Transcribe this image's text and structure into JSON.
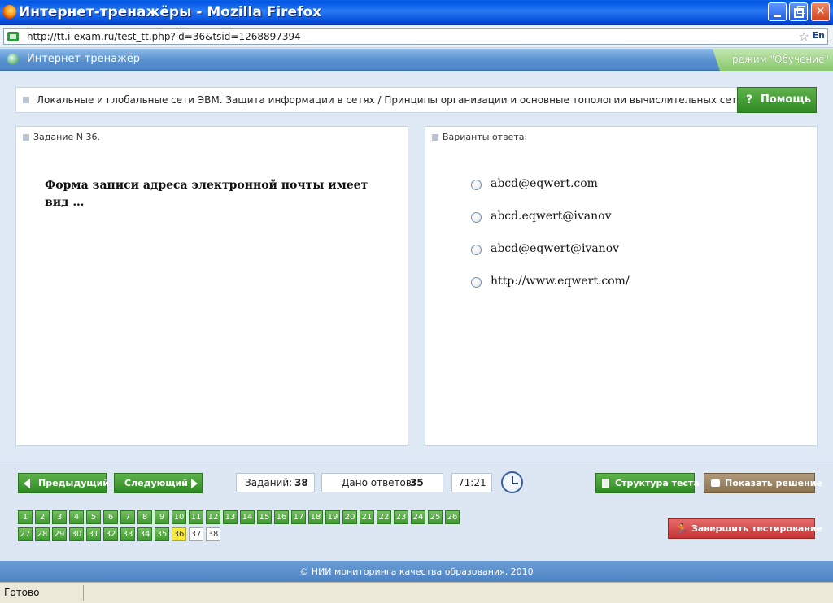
{
  "window": {
    "title": "Интернет-тренажёры - Mozilla Firefox",
    "url": "http://tt.i-exam.ru/test_tt.php?id=36&tsid=1268897394",
    "lang": "En"
  },
  "app": {
    "title": "Интернет-тренажёр",
    "mode": "режим \"Обучение\""
  },
  "topic": {
    "text": "Локальные и глобальные сети ЭВМ. Защита информации в сетях / Принципы организации и основные топологии вычислительных сетей. Принципы ...",
    "help_label": "Помощь"
  },
  "task": {
    "header": "Задание N 36.",
    "question": "Форма записи адреса электронной почты имеет вид …"
  },
  "answers": {
    "header": "Варианты ответа:",
    "options": [
      "abcd@eqwert.com",
      "abcd.eqwert@ivanov",
      "abcd@eqwert@ivanov",
      "http://www.eqwert.com/"
    ]
  },
  "toolbar": {
    "prev_label": "Предыдущий",
    "next_label": "Следующий",
    "tasks_label": "Заданий:",
    "tasks_value": "38",
    "answers_label": "Дано ответов:",
    "answers_value": "35",
    "timer": "71:21",
    "structure_label": "Структура теста",
    "solution_label": "Показать решение",
    "finish_label": "Завершить тестирование"
  },
  "navigation": {
    "current": 36,
    "unanswered": [
      37,
      38
    ],
    "numbers": [
      "1",
      "2",
      "3",
      "4",
      "5",
      "6",
      "7",
      "8",
      "9",
      "10",
      "11",
      "12",
      "13",
      "14",
      "15",
      "16",
      "17",
      "18",
      "19",
      "20",
      "21",
      "22",
      "23",
      "24",
      "25",
      "26",
      "27",
      "28",
      "29",
      "30",
      "31",
      "32",
      "33",
      "34",
      "35",
      "36",
      "37",
      "38"
    ]
  },
  "footer": {
    "copyright": "© НИИ мониторинга качества образования, 2010"
  },
  "status": {
    "text": "Готово"
  },
  "colors": {
    "green_button": "#3f9a30",
    "current_question": "#f5e93c",
    "finish_button": "#c23434",
    "solution_button": "#8a7250"
  }
}
